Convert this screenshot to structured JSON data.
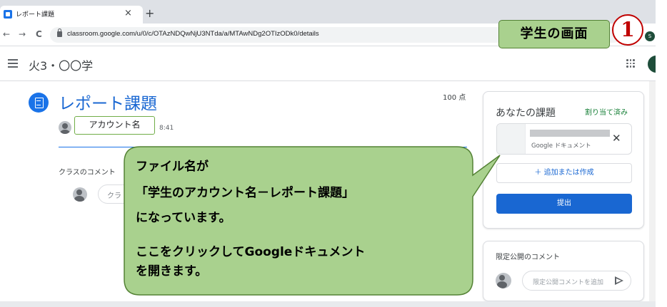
{
  "browser": {
    "tab_title": "レポート課題",
    "tab_close": "×",
    "new_tab": "+",
    "back": "←",
    "forward": "→",
    "reload": "C",
    "url": "classroom.google.com/u/0/c/OTAzNDQwNjU3NTda/a/MTAwNDg2OTIzODk0/details",
    "profile_initial": "S"
  },
  "appbar": {
    "class_name": "火3・〇〇学"
  },
  "assignment": {
    "title": "レポート課題",
    "points": "100 点",
    "account_label": "アカウント名",
    "time": "8:41",
    "class_comments_label": "クラスのコメント",
    "comment_placeholder": "クラ"
  },
  "your_work": {
    "title": "あなたの課題",
    "status": "割り当て済み",
    "attachment_type": "Google ドキュメント",
    "remove": "✕",
    "add_button": "＋ 追加または作成",
    "submit_button": "提出"
  },
  "private_comments": {
    "title": "限定公開のコメント",
    "placeholder": "限定公開コメントを追加"
  },
  "annotations": {
    "screen_label": "学生の画面",
    "step_number": "1",
    "callout_lines": [
      "ファイル名が",
      "「学生のアカウント名－レポート課題」",
      "になっています。",
      "ここをクリックしてGoogleドキュメント",
      "を開きます。"
    ],
    "callout_fill": "#a9d18e",
    "callout_border": "#548235",
    "step_color": "#c00000"
  },
  "colors": {
    "accent_blue": "#1967d2",
    "status_green": "#188038"
  }
}
